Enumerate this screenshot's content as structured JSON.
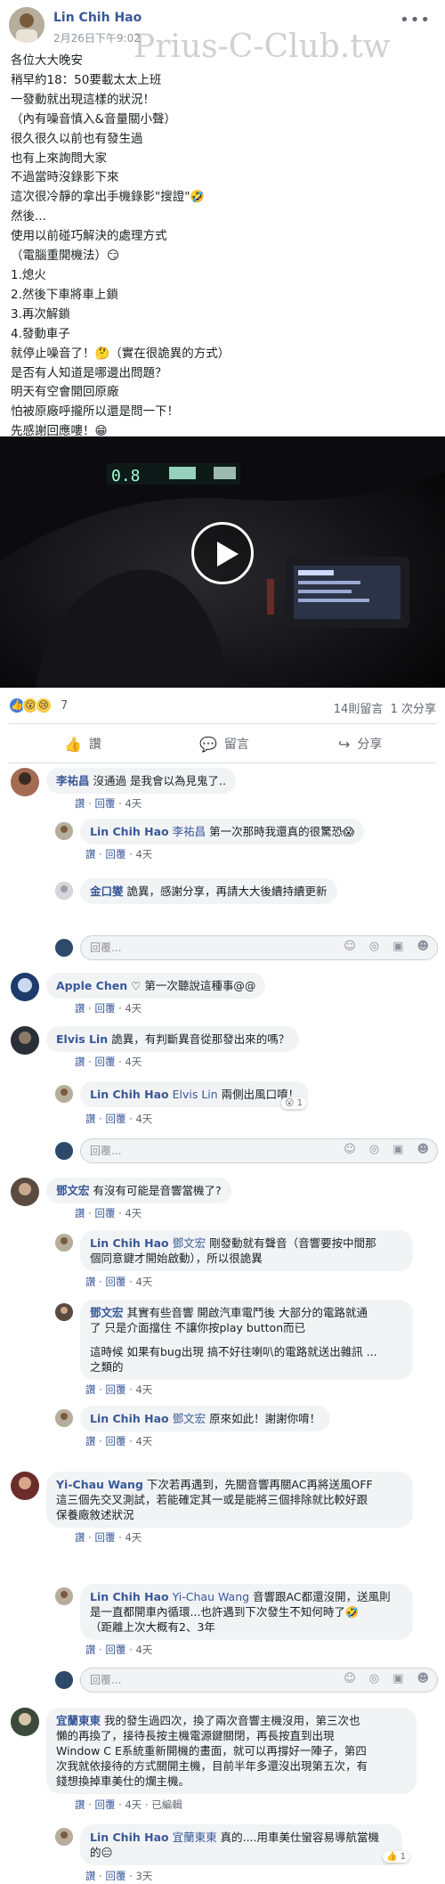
{
  "post": {
    "author": "Lin Chih Hao",
    "time": "2月26日下午9:02",
    "watermark": "Prius-C-Club.tw",
    "lines": [
      "各位大大晚安",
      "稍早約18：50要載太太上班",
      "一發動就出現這樣的狀況！",
      "（內有噪音慎入&音量關小聲）",
      "很久很久以前也有發生過",
      "也有上來詢問大家",
      "不過當時沒錄影下來",
      "這次很冷靜的拿出手機錄影\"搜證\"🤣",
      "然後...",
      "使用以前碰巧解決的處理方式",
      "（電腦重開機法）😏",
      "1.熄火",
      "2.然後下車將車上鎖",
      "3.再次解鎖",
      "4.發動車子",
      "就停止噪音了！🤔（實在很詭異的方式）",
      "是否有人知道是哪邊出問題？",
      "明天有空會開回原廠",
      "怕被原廠呼攏所以還是問一下！",
      "先感謝回應嘍！😁"
    ],
    "reaction_count": "7",
    "comment_count": "14則留言",
    "share_count": "1 次分享"
  },
  "actions": {
    "like": "讚",
    "comment": "留言",
    "share": "分享"
  },
  "labels": {
    "like": "讚",
    "reply": "回覆",
    "composer_placeholder": "回覆..."
  },
  "comments": {
    "c1": {
      "author": "李祐昌",
      "text": "沒通過 是我會以為見鬼了..",
      "time": "4天"
    },
    "c1r1": {
      "author": "Lin Chih Hao",
      "mention": "李祐昌",
      "text": "第一次那時我還真的很驚恐😱",
      "time": "4天"
    },
    "c1r2": {
      "author": "金口燮",
      "text": "詭異，感謝分享，再請大大後續持續更新"
    },
    "c2": {
      "author": "Apple Chen",
      "badge": "♡",
      "text": "第一次聽說這種事@@",
      "time": "4天"
    },
    "c3": {
      "author": "Elvis Lin",
      "text": "詭異，有判斷異音從那發出來的嗎？",
      "time": "4天"
    },
    "c3r1": {
      "author": "Lin Chih Hao",
      "mention": "Elvis Lin",
      "text": "兩側出風口唷！",
      "time": "4天",
      "react": "😮 1"
    },
    "c4": {
      "author": "鄧文宏",
      "text": "有沒有可能是音響當機了?",
      "time": "4天"
    },
    "c4r1": {
      "author": "Lin Chih Hao",
      "mention": "鄧文宏",
      "text": "剛發動就有聲音（音響要按中間那",
      "text2": "個同意鍵才開始啟動），所以很詭異",
      "time": "4天"
    },
    "c4r2": {
      "author": "鄧文宏",
      "text": "其實有些音響 開啟汽車電鬥後 大部分的電路就通",
      "text2": "了 只是介面擋住 不讓你按play button而已",
      "text3": "這時候 如果有bug出現 搞不好往喇叭的電路就送出雜訊 ...",
      "text4": "之類的",
      "time": "4天"
    },
    "c4r3": {
      "author": "Lin Chih Hao",
      "mention": "鄧文宏",
      "text": "原來如此！謝謝你唷！",
      "time": "4天"
    },
    "c5": {
      "author": "Yi-Chau Wang",
      "text": "下次若再遇到，先關音響再關AC再將送風OFF",
      "text2": "這三個先交叉測試，若能確定其一或是能將三個排除就比較好跟",
      "text3": "保養廠敘述狀況",
      "time": "4天"
    },
    "c5r1": {
      "author": "Lin Chih Hao",
      "mention": "Yi-Chau Wang",
      "text": "音響跟AC都還沒開，送風則",
      "text2": "是一直都開車內循環...也許遇到下次發生不知何時了🤣",
      "text3": "（距離上次大概有2、3年",
      "time": "4天"
    },
    "c6": {
      "author": "宜蘭東東",
      "text": "我的發生過四次，換了兩次音響主機沒用，第三次也",
      "text2": "懶的再換了，接待長按主機電源鍵關閉，再長按直到出現",
      "text3": "Window C E系統重新開機的畫面，就可以再撐好一陣子，第四",
      "text4": "次我就依接待的方式關開主機，目前半年多還沒出現第五次，有",
      "text5": "錢想換掉車美仕的爛主機。",
      "time": "4天",
      "edited": "已編輯"
    },
    "c6r1": {
      "author": "Lin Chih Hao",
      "mention": "宜蘭東東",
      "text": "真的....用車美仕蠻容易導航當機",
      "text2": "的😑",
      "time": "3天",
      "react": "👍 1"
    }
  },
  "colors": {
    "link": "#385898",
    "bubble": "#f2f3f5",
    "meta": "#606770"
  }
}
